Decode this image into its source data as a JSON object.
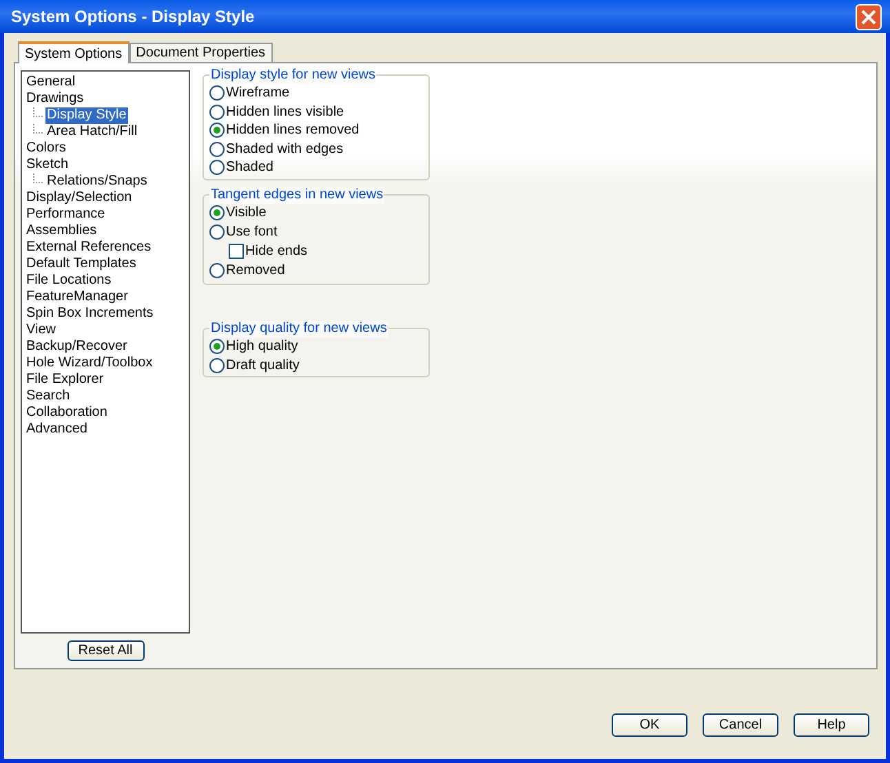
{
  "window": {
    "title": "System Options - Display Style"
  },
  "tabs": [
    {
      "label": "System Options",
      "selected": true
    },
    {
      "label": "Document Properties",
      "selected": false
    }
  ],
  "tree": [
    {
      "label": "General",
      "selected": false
    },
    {
      "label": "Drawings",
      "selected": false,
      "children": [
        {
          "label": "Display Style",
          "selected": true
        },
        {
          "label": "Area Hatch/Fill",
          "selected": false
        }
      ]
    },
    {
      "label": "Colors",
      "selected": false
    },
    {
      "label": "Sketch",
      "selected": false,
      "children": [
        {
          "label": "Relations/Snaps",
          "selected": false
        }
      ]
    },
    {
      "label": "Display/Selection",
      "selected": false
    },
    {
      "label": "Performance",
      "selected": false
    },
    {
      "label": "Assemblies",
      "selected": false
    },
    {
      "label": "External References",
      "selected": false
    },
    {
      "label": "Default Templates",
      "selected": false
    },
    {
      "label": "File Locations",
      "selected": false
    },
    {
      "label": "FeatureManager",
      "selected": false
    },
    {
      "label": "Spin Box Increments",
      "selected": false
    },
    {
      "label": "View",
      "selected": false
    },
    {
      "label": "Backup/Recover",
      "selected": false
    },
    {
      "label": "Hole Wizard/Toolbox",
      "selected": false
    },
    {
      "label": "File Explorer",
      "selected": false
    },
    {
      "label": "Search",
      "selected": false
    },
    {
      "label": "Collaboration",
      "selected": false
    },
    {
      "label": "Advanced",
      "selected": false
    }
  ],
  "reset_button": "Reset All",
  "groups": [
    {
      "title": "Display style for new views",
      "options": [
        {
          "kind": "radio",
          "label": "Wireframe",
          "selected": false
        },
        {
          "kind": "radio",
          "label": "Hidden lines visible",
          "selected": false
        },
        {
          "kind": "radio",
          "label": "Hidden lines removed",
          "selected": true
        },
        {
          "kind": "radio",
          "label": "Shaded with edges",
          "selected": false
        },
        {
          "kind": "radio",
          "label": "Shaded",
          "selected": false
        }
      ]
    },
    {
      "title": "Tangent edges in new views",
      "options": [
        {
          "kind": "radio",
          "label": "Visible",
          "selected": true
        },
        {
          "kind": "radio",
          "label": "Use font",
          "selected": false,
          "children": [
            {
              "kind": "checkbox",
              "label": "Hide ends",
              "checked": false
            }
          ]
        },
        {
          "kind": "radio",
          "label": "Removed",
          "selected": false
        }
      ]
    },
    {
      "title": "Display quality for new views",
      "options": [
        {
          "kind": "radio",
          "label": "High quality",
          "selected": true
        },
        {
          "kind": "radio",
          "label": "Draft quality",
          "selected": false
        }
      ]
    }
  ],
  "buttons": [
    "OK",
    "Cancel",
    "Help"
  ]
}
